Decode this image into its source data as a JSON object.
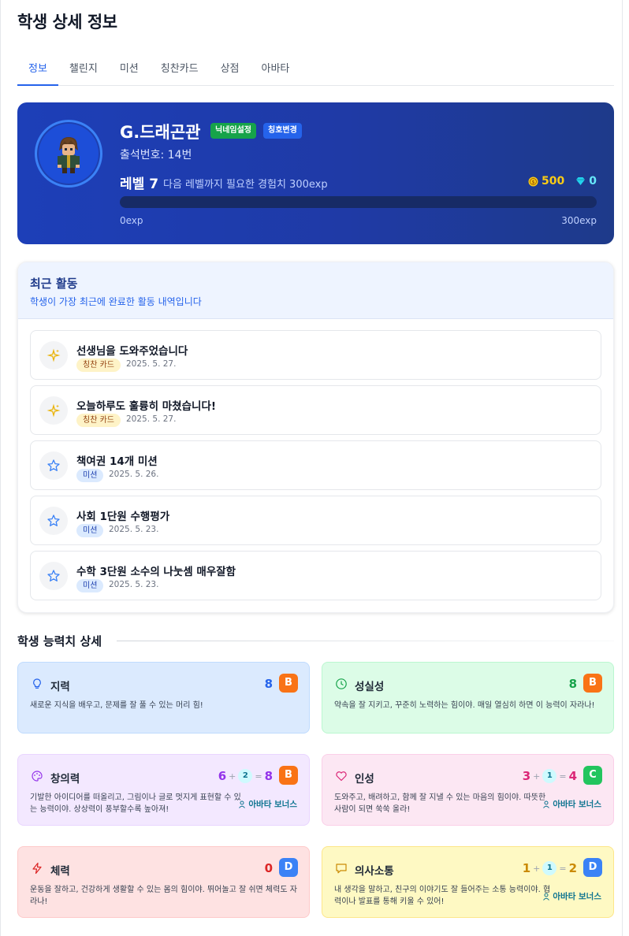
{
  "page": {
    "title": "학생 상세 정보"
  },
  "tabs": [
    {
      "label": "정보",
      "active": true
    },
    {
      "label": "챌린지"
    },
    {
      "label": "미션"
    },
    {
      "label": "칭찬카드"
    },
    {
      "label": "상점"
    },
    {
      "label": "아바타"
    }
  ],
  "profile": {
    "name": "G.드래곤관",
    "nickname_button": "닉네임설정",
    "title_button": "칭호변경",
    "attendance": "출석번호: 14번",
    "level": "레벨 7",
    "level_hint": "다음 레벨까지 필요한 경험치 300exp",
    "coins": "500",
    "gems": "0",
    "xp_progress": 0,
    "xp_min": "0exp",
    "xp_max": "300exp",
    "colors": {
      "coin": "#facc15",
      "gem": "#67e8f9",
      "hero_bg": "#1f3aa6"
    }
  },
  "activity": {
    "title": "최근 활동",
    "subtitle": "학생이 가장 최근에 완료한 활동 내역입니다",
    "items": [
      {
        "title": "선생님을 도와주었습니다",
        "tag": "칭찬 카드",
        "date": "2025. 5. 27.",
        "icon": "sparkles-icon"
      },
      {
        "title": "오늘하루도 훌륭히 마쳤습니다!",
        "tag": "칭찬 카드",
        "date": "2025. 5. 27.",
        "icon": "sparkles-icon"
      },
      {
        "title": "책여권 14개 미션",
        "tag": "미션",
        "date": "2025. 5. 26.",
        "icon": "star-icon"
      },
      {
        "title": "사회 1단원 수행평가",
        "tag": "미션",
        "date": "2025. 5. 23.",
        "icon": "star-icon"
      },
      {
        "title": "수학 3단원 소수의 나눗셈 매우잘함",
        "tag": "미션",
        "date": "2025. 5. 23.",
        "icon": "star-icon"
      }
    ]
  },
  "stats": {
    "title": "학생 능력치 상세",
    "avatar_bonus_label": "아바타 보너스",
    "items": [
      {
        "name": "지력",
        "icon": "lightbulb-icon",
        "score": "8",
        "grade": "B",
        "desc": "새로운 지식을 배우고, 문제를 잘 풀 수 있는 머리 힘!",
        "color": "#2563eb"
      },
      {
        "name": "성실성",
        "icon": "clock-icon",
        "score": "8",
        "grade": "B",
        "desc": "약속을 잘 지키고, 꾸준히 노력하는 힘이야. 매일 열심히 하면 이 능력이 자라나!",
        "color": "#16a34a"
      },
      {
        "name": "창의력",
        "icon": "palette-icon",
        "base": "6",
        "bonus": "2",
        "score": "8",
        "grade": "B",
        "desc": "기발한 아이디어를 떠올리고, 그림이나 글로 멋지게 표현할 수 있는 능력이야. 상상력이 풍부할수록 높아져!",
        "color": "#9333ea"
      },
      {
        "name": "인성",
        "icon": "heart-icon",
        "base": "3",
        "bonus": "1",
        "score": "4",
        "grade": "C",
        "desc": "도와주고, 배려하고, 함께 잘 지낼 수 있는 마음의 힘이야. 따뜻한 사람이 되면 쑥쑥 올라!",
        "color": "#db2777"
      },
      {
        "name": "체력",
        "icon": "lightning-icon",
        "score": "0",
        "grade": "D",
        "desc": "운동을 잘하고, 건강하게 생활할 수 있는 몸의 힘이야. 뛰어놀고 잘 쉬면 체력도 자라나!",
        "color": "#dc2626"
      },
      {
        "name": "의사소통",
        "icon": "chat-icon",
        "base": "1",
        "bonus": "1",
        "score": "2",
        "grade": "D",
        "desc": "내 생각을 말하고, 친구의 이야기도 잘 들어주는 소통 능력이야. 협력이나 발표를 통해 키울 수 있어!",
        "color": "#ca8a04"
      }
    ]
  }
}
